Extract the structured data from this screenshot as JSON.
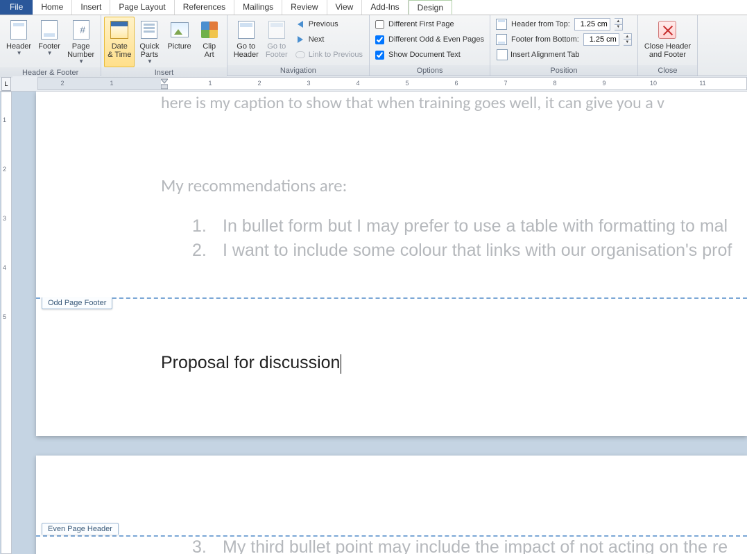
{
  "tabs": {
    "file": "File",
    "home": "Home",
    "insert": "Insert",
    "page_layout": "Page Layout",
    "references": "References",
    "mailings": "Mailings",
    "review": "Review",
    "view": "View",
    "addins": "Add-Ins",
    "design": "Design"
  },
  "ribbon": {
    "hf": {
      "header": "Header",
      "footer": "Footer",
      "page_number": "Page\nNumber",
      "title": "Header & Footer"
    },
    "insert": {
      "date_time": "Date\n& Time",
      "quick_parts": "Quick\nParts",
      "picture": "Picture",
      "clip_art": "Clip\nArt",
      "title": "Insert"
    },
    "nav": {
      "goto_header": "Go to\nHeader",
      "goto_footer": "Go to\nFooter",
      "previous": "Previous",
      "next": "Next",
      "link": "Link to Previous",
      "title": "Navigation"
    },
    "options": {
      "diff_first": "Different First Page",
      "diff_odd_even": "Different Odd & Even Pages",
      "show_doc": "Show Document Text",
      "title": "Options",
      "checked": {
        "diff_first": false,
        "diff_odd_even": true,
        "show_doc": true
      }
    },
    "position": {
      "header_top": "Header from Top:",
      "footer_bottom": "Footer from Bottom:",
      "align_tab": "Insert Alignment Tab",
      "header_val": "1.25 cm",
      "footer_val": "1.25 cm",
      "title": "Position"
    },
    "close": {
      "label": "Close Header\nand Footer",
      "title": "Close"
    }
  },
  "ruler": {
    "tabchar": "L",
    "nums": [
      "2",
      "1",
      "1",
      "2",
      "3",
      "4",
      "5",
      "6",
      "7",
      "8",
      "9",
      "10",
      "11"
    ]
  },
  "vruler": {
    "nums": [
      "1",
      "2",
      "3",
      "4",
      "5"
    ]
  },
  "doc": {
    "caption": "here is my caption to show that when training goes well, it can give you a   v",
    "recs": "My recommendations are:",
    "bullets": [
      {
        "n": "1.",
        "t": "In bullet form but I may prefer to use a table with formatting to mal"
      },
      {
        "n": "2.",
        "t": "I want to include some colour that links with our organisation's prof"
      }
    ],
    "bullet3": {
      "n": "3.",
      "t": "My third bullet point may include the impact of not acting on the re"
    },
    "footer_text": "Proposal for discussion",
    "odd_footer_tag": "Odd Page Footer",
    "even_header_tag": "Even Page Header"
  }
}
